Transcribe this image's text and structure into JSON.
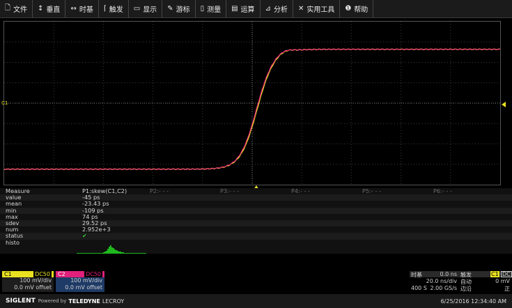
{
  "menu": [
    {
      "icon": "file-icon",
      "glyph": "🗋",
      "label": "文件"
    },
    {
      "icon": "vertical-icon",
      "glyph": "↕",
      "label": "垂直"
    },
    {
      "icon": "horizontal-icon",
      "glyph": "↔",
      "label": "时基"
    },
    {
      "icon": "trigger-icon",
      "glyph": "⌈",
      "label": "触发"
    },
    {
      "icon": "display-icon",
      "glyph": "▭",
      "label": "显示"
    },
    {
      "icon": "cursor-icon",
      "glyph": "✎",
      "label": "游标"
    },
    {
      "icon": "measure-icon",
      "glyph": "▯",
      "label": "测量"
    },
    {
      "icon": "math-icon",
      "glyph": "▤",
      "label": "运算"
    },
    {
      "icon": "analysis-icon",
      "glyph": "⊿",
      "label": "分析"
    },
    {
      "icon": "tools-icon",
      "glyph": "✕",
      "label": "实用工具"
    },
    {
      "icon": "help-icon",
      "glyph": "❶",
      "label": "帮助"
    }
  ],
  "grid": {
    "ch1_marker": "C1"
  },
  "waveform": {
    "ch1_color": "#e8e020",
    "ch2_color": "#e0207a",
    "low_level_frac": 0.905,
    "high_level_frac": 0.17,
    "edge_center_frac": 0.51
  },
  "measure": {
    "header": "Measure",
    "p1": "P1:skew(C1,C2)",
    "p2": "P2:- - -",
    "p3": "P3:- - -",
    "p4": "P4:- - -",
    "p5": "P5:- - -",
    "p6": "P6:- - -",
    "rows": [
      {
        "label": "value",
        "value": "-45 ps"
      },
      {
        "label": "mean",
        "value": "-23.43 ps"
      },
      {
        "label": "min",
        "value": "-109 ps"
      },
      {
        "label": "max",
        "value": "74 ps"
      },
      {
        "label": "sdev",
        "value": "29.52 ps"
      },
      {
        "label": "num",
        "value": "2.952e+3"
      },
      {
        "label": "status",
        "value": "✔"
      },
      {
        "label": "histo",
        "value": ""
      }
    ]
  },
  "ch1": {
    "name": "C1",
    "coupling": "DC50",
    "scale": "100 mV/div",
    "offset": "0.0 mV offset",
    "color": "#e8e020"
  },
  "ch2": {
    "name": "C2",
    "coupling": "DC50",
    "scale": "100 mV/div",
    "offset": "0.0 mV offset",
    "color": "#e0207a"
  },
  "timebase": {
    "label": "时基",
    "delay": "0.0 ns",
    "scale": "20.0 ns/div",
    "points": "400 S",
    "rate": "2.00 GS/s"
  },
  "trigger": {
    "label": "触发",
    "source": "C1",
    "coupling": "DC",
    "mode": "自动",
    "level": "0 mV",
    "type": "边沿",
    "slope": "正"
  },
  "footer": {
    "brand": "SIGLENT",
    "powered": "Powered by",
    "partner": "TELEDYNE",
    "partner2": "LECROY",
    "datetime": "6/25/2016 12:34:40 AM"
  }
}
